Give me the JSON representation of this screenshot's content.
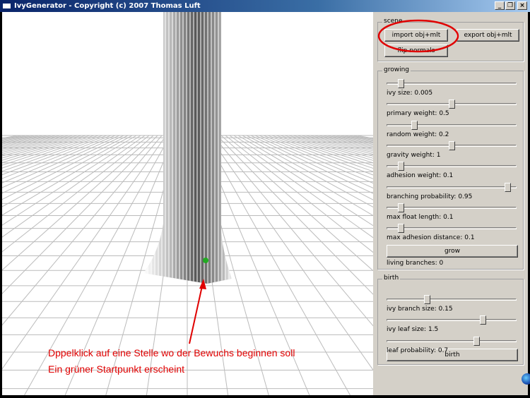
{
  "window": {
    "title": "IvyGenerator  - Copyright (c) 2007 Thomas Luft",
    "minimize": "_",
    "restore": "❐",
    "close": "×"
  },
  "scene": {
    "legend": "scene",
    "import": "import obj+mlt",
    "export": "export obj+mlt",
    "flip": "flip normals"
  },
  "growing": {
    "legend": "growing",
    "params": [
      {
        "label": "ivy size: 0.005",
        "value": 0.11
      },
      {
        "label": "primary weight: 0.5",
        "value": 0.5
      },
      {
        "label": "random weight: 0.2",
        "value": 0.21
      },
      {
        "label": "gravity weight: 1",
        "value": 0.5
      },
      {
        "label": "adhesion weight: 0.1",
        "value": 0.11
      },
      {
        "label": "branching probability: 0.95",
        "value": 0.93
      },
      {
        "label": "max float length: 0.1",
        "value": 0.11
      },
      {
        "label": "max adhesion distance: 0.1",
        "value": 0.11
      }
    ],
    "grow": "grow",
    "living": "living branches: 0"
  },
  "birth": {
    "legend": "birth",
    "params": [
      {
        "label": "ivy branch size: 0.15",
        "value": 0.31
      },
      {
        "label": "ivy leaf size: 1.5",
        "value": 0.74
      },
      {
        "label": "leaf probability: 0.7",
        "value": 0.69
      }
    ],
    "birth": "birth"
  },
  "annotation": {
    "line1": "Dppelklick auf eine Stelle wo der Bewuchs beginnen soll",
    "line2": "Ein grüner Startpunkt erscheint",
    "color": "#e00000"
  }
}
